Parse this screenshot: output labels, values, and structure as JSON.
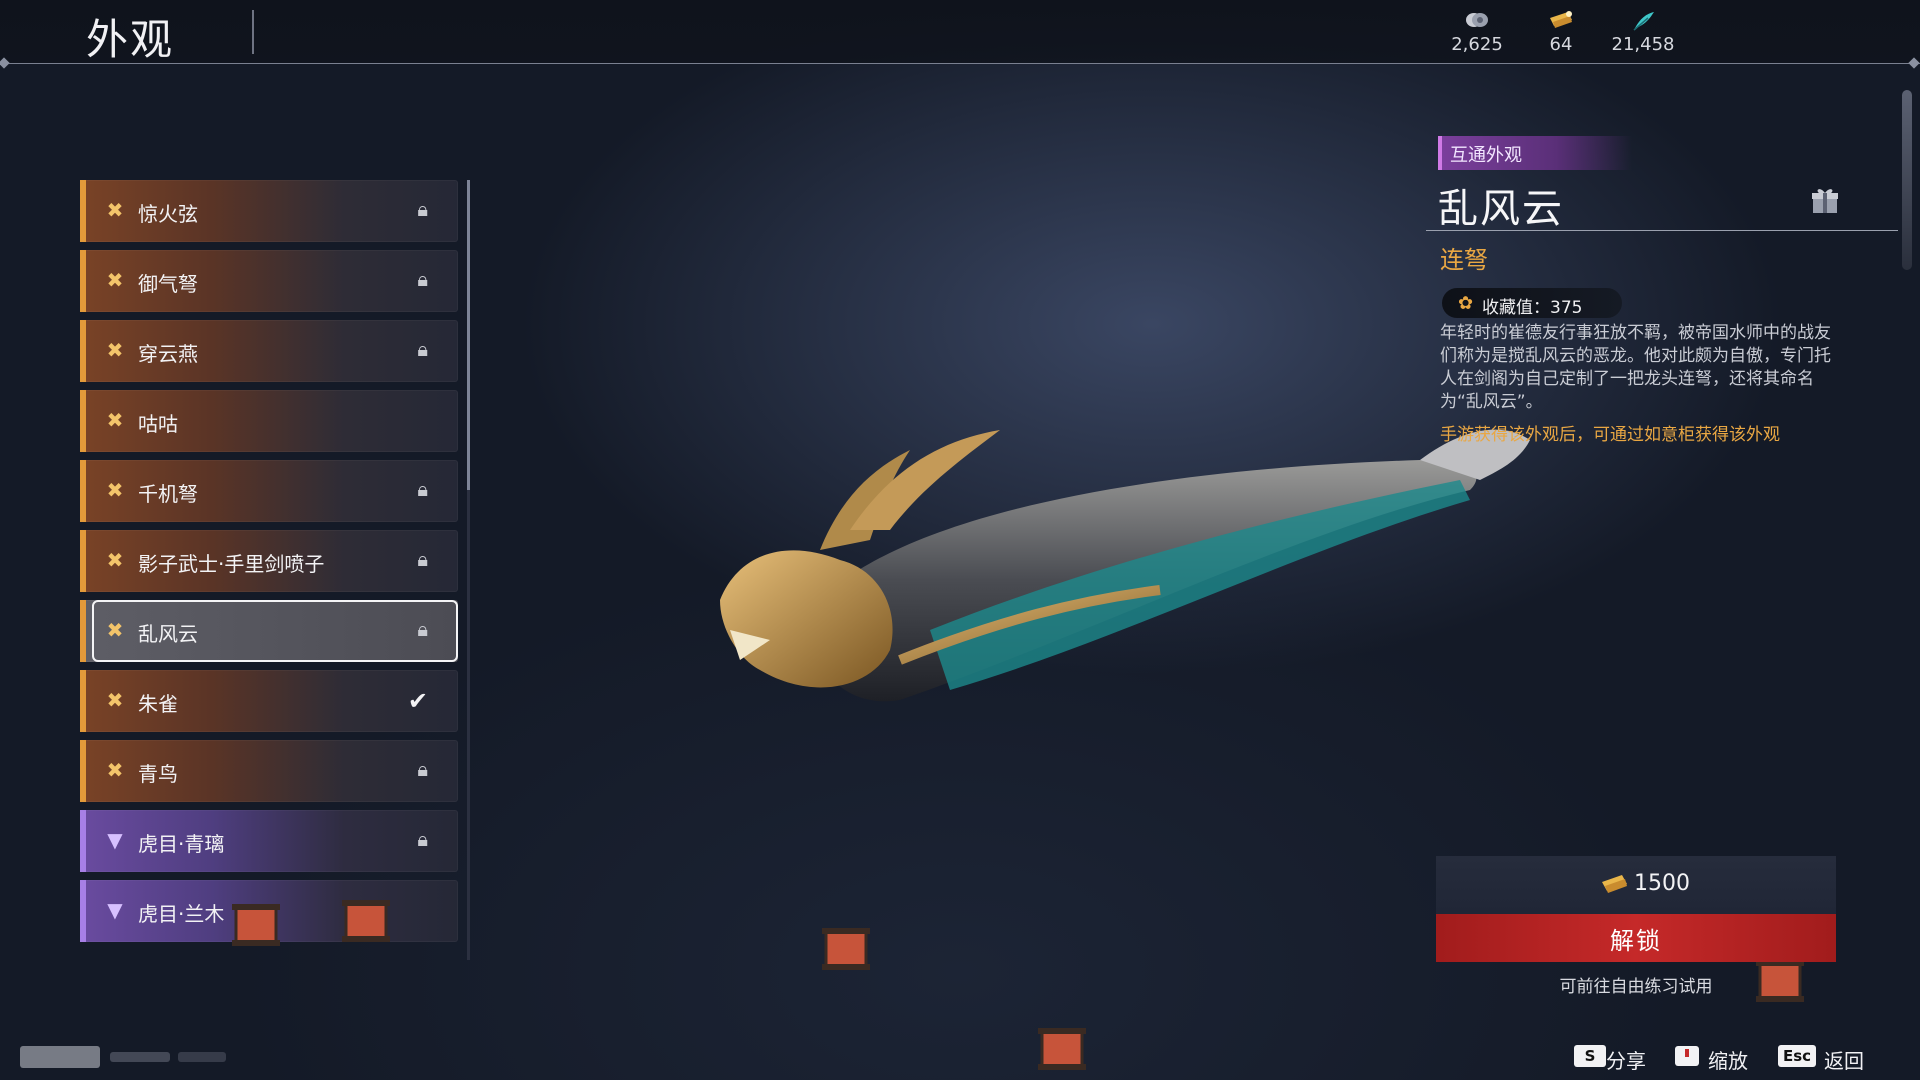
{
  "header": {
    "title": "外观",
    "currencies": [
      {
        "icon": "coin-icon",
        "value": "2,625"
      },
      {
        "icon": "ticket-icon",
        "value": "64"
      },
      {
        "icon": "feather-icon",
        "value": "21,458"
      }
    ]
  },
  "list": {
    "items": [
      {
        "name": "惊火弦",
        "rarity": "gold",
        "status": "locked"
      },
      {
        "name": "御气弩",
        "rarity": "gold",
        "status": "locked"
      },
      {
        "name": "穿云燕",
        "rarity": "gold",
        "status": "locked"
      },
      {
        "name": "咕咕",
        "rarity": "gold",
        "status": "none"
      },
      {
        "name": "千机弩",
        "rarity": "gold",
        "status": "locked"
      },
      {
        "name": "影子武士·手里剑喷子",
        "rarity": "gold",
        "status": "locked"
      },
      {
        "name": "乱风云",
        "rarity": "gold",
        "status": "locked",
        "selected": true
      },
      {
        "name": "朱雀",
        "rarity": "gold",
        "status": "equipped"
      },
      {
        "name": "青鸟",
        "rarity": "gold",
        "status": "locked"
      },
      {
        "name": "虎目·青璃",
        "rarity": "purple",
        "status": "locked"
      },
      {
        "name": "虎目·兰木",
        "rarity": "purple",
        "status": "none"
      }
    ]
  },
  "detail": {
    "tag": "互通外观",
    "name": "乱风云",
    "type": "连弩",
    "collection": "收藏值：375",
    "description": "年轻时的崔德友行事狂放不羁，被帝国水师中的战友们称为是搅乱风云的恶龙。他对此颇为自傲，专门托人在剑阁为自己定制了一把龙头连弩，还将其命名为“乱风云”。",
    "hint": "手游获得该外观后，可通过如意柜获得该外观"
  },
  "purchase": {
    "price": "1500",
    "unlock_label": "解锁",
    "trial_text": "可前往自由练习试用"
  },
  "hotkeys": [
    {
      "key": "S",
      "label": "分享"
    },
    {
      "key": "",
      "label": "缩放"
    },
    {
      "key": "Esc",
      "label": "返回"
    }
  ],
  "colors": {
    "gold_accent": "#e39a3a",
    "purple_accent": "#a77fe6",
    "type_text": "#e9a743",
    "unlock_button": "#c52929"
  }
}
